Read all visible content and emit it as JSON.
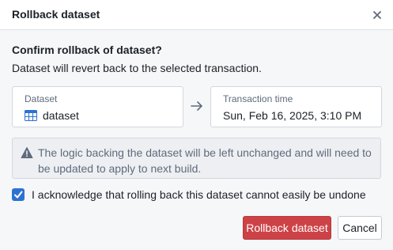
{
  "dialog": {
    "title": "Rollback dataset",
    "close_icon": "close-icon"
  },
  "body": {
    "heading": "Confirm rollback of dataset?",
    "description": "Dataset will revert back to the selected transaction."
  },
  "dataset_card": {
    "label": "Dataset",
    "value": "dataset",
    "icon": "table-icon"
  },
  "transaction_card": {
    "label": "Transaction time",
    "value": "Sun, Feb 16, 2025, 3:10 PM"
  },
  "callout": {
    "icon": "warning-icon",
    "text": "The logic backing the dataset will be left unchanged and will need to be updated to apply to next build."
  },
  "acknowledge": {
    "checked": true,
    "label": "I acknowledge that rolling back this dataset cannot easily be undone"
  },
  "actions": {
    "confirm_label": "Rollback dataset",
    "cancel_label": "Cancel"
  },
  "colors": {
    "danger": "#cd4246",
    "checkbox": "#2d72d2",
    "muted_text": "#5f6b7c"
  }
}
